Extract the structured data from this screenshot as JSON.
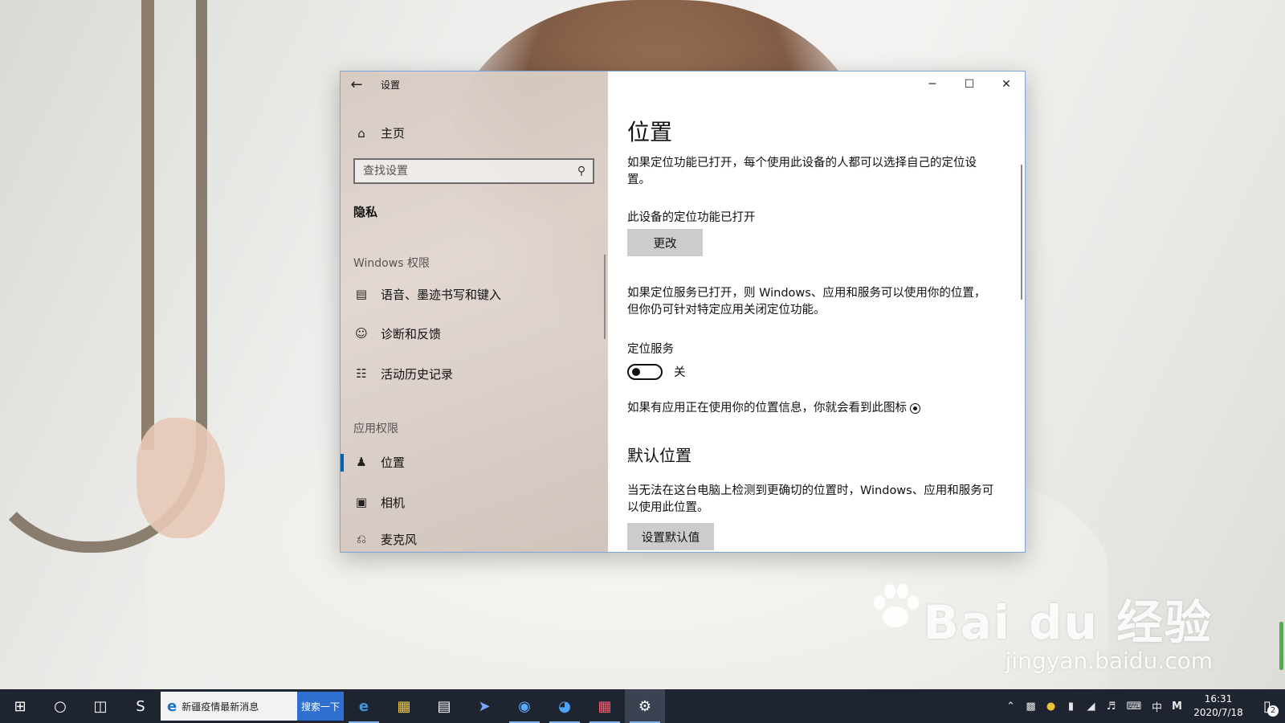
{
  "window": {
    "title": "设置",
    "controls": {
      "minimize": "─",
      "maximize": "☐",
      "close": "✕"
    }
  },
  "sidebar": {
    "home_label": "主页",
    "search_placeholder": "查找设置",
    "section_title": "隐私",
    "group_windows": "Windows 权限",
    "windows_items": [
      {
        "label": "语音、墨迹书写和键入",
        "icon": "clipboard-icon"
      },
      {
        "label": "诊断和反馈",
        "icon": "person-feedback-icon"
      },
      {
        "label": "活动历史记录",
        "icon": "timeline-icon"
      }
    ],
    "group_apps": "应用权限",
    "app_items": [
      {
        "label": "位置",
        "icon": "location-person-icon",
        "active": true
      },
      {
        "label": "相机",
        "icon": "camera-icon"
      },
      {
        "label": "麦克风",
        "icon": "microphone-icon"
      }
    ]
  },
  "main": {
    "title": "位置",
    "intro": "如果定位功能已打开，每个使用此设备的人都可以选择自己的定位设置。",
    "device_status": "此设备的定位功能已打开",
    "change_button": "更改",
    "service_desc": "如果定位服务已打开，则 Windows、应用和服务可以使用你的位置，但你仍可针对特定应用关闭定位功能。",
    "service_title": "定位服务",
    "service_toggle_state": "关",
    "service_toggle_on": false,
    "icon_note": "如果有应用正在使用你的位置信息，你就会看到此图标",
    "default_title": "默认位置",
    "default_desc": "当无法在这台电脑上检测到更确切的位置时，Windows、应用和服务可以使用此位置。",
    "default_button": "设置默认值"
  },
  "taskbar": {
    "news_text": "新疆疫情最新消息",
    "search_button": "搜索一下",
    "time": "16:31",
    "date": "2020/7/18",
    "ime": "中",
    "notification_count": "2"
  },
  "watermark": {
    "brand": "Bai du 经验",
    "url": "jingyan.baidu.com"
  },
  "colors": {
    "accent": "#0063b1",
    "taskbar": "#1f2530",
    "button": "#cccccc"
  }
}
